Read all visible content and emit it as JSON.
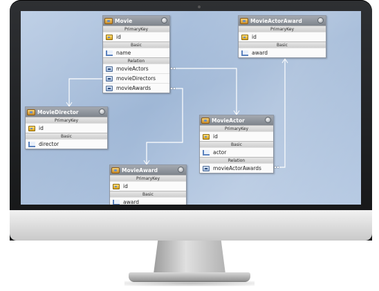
{
  "diagram": {
    "entities": [
      {
        "id": "movie",
        "title": "Movie",
        "sections": [
          {
            "label": "PrimaryKey",
            "fields": [
              {
                "name": "id",
                "icon": "key-icon"
              }
            ]
          },
          {
            "label": "Basic",
            "fields": [
              {
                "name": "name",
                "icon": "basic-field-icon"
              }
            ]
          },
          {
            "label": "Relation",
            "fields": [
              {
                "name": "movieActors",
                "icon": "relation-icon"
              },
              {
                "name": "movieDirectors",
                "icon": "relation-icon"
              },
              {
                "name": "movieAwards",
                "icon": "relation-icon"
              }
            ]
          }
        ]
      },
      {
        "id": "movie-actor-award",
        "title": "MovieActorAward",
        "sections": [
          {
            "label": "PrimaryKey",
            "fields": [
              {
                "name": "id",
                "icon": "key-icon"
              }
            ]
          },
          {
            "label": "Basic",
            "fields": [
              {
                "name": "award",
                "icon": "basic-field-icon"
              }
            ]
          }
        ]
      },
      {
        "id": "movie-director",
        "title": "MovieDirector",
        "sections": [
          {
            "label": "PrimaryKey",
            "fields": [
              {
                "name": "id",
                "icon": "key-icon"
              }
            ]
          },
          {
            "label": "Basic",
            "fields": [
              {
                "name": "director",
                "icon": "basic-field-icon"
              }
            ]
          }
        ]
      },
      {
        "id": "movie-actor",
        "title": "MovieActor",
        "sections": [
          {
            "label": "PrimaryKey",
            "fields": [
              {
                "name": "id",
                "icon": "key-icon"
              }
            ]
          },
          {
            "label": "Basic",
            "fields": [
              {
                "name": "actor",
                "icon": "basic-field-icon"
              }
            ]
          },
          {
            "label": "Relation",
            "fields": [
              {
                "name": "movieActorAwards",
                "icon": "relation-icon"
              }
            ]
          }
        ]
      },
      {
        "id": "movie-award",
        "title": "MovieAward",
        "sections": [
          {
            "label": "PrimaryKey",
            "fields": [
              {
                "name": "id",
                "icon": "key-icon"
              }
            ]
          },
          {
            "label": "Basic",
            "fields": [
              {
                "name": "award",
                "icon": "basic-field-icon"
              }
            ]
          }
        ]
      }
    ]
  },
  "colors": {
    "canvas": "#a9bfdc",
    "header": "#8d939a",
    "connector": "#ffffff"
  }
}
